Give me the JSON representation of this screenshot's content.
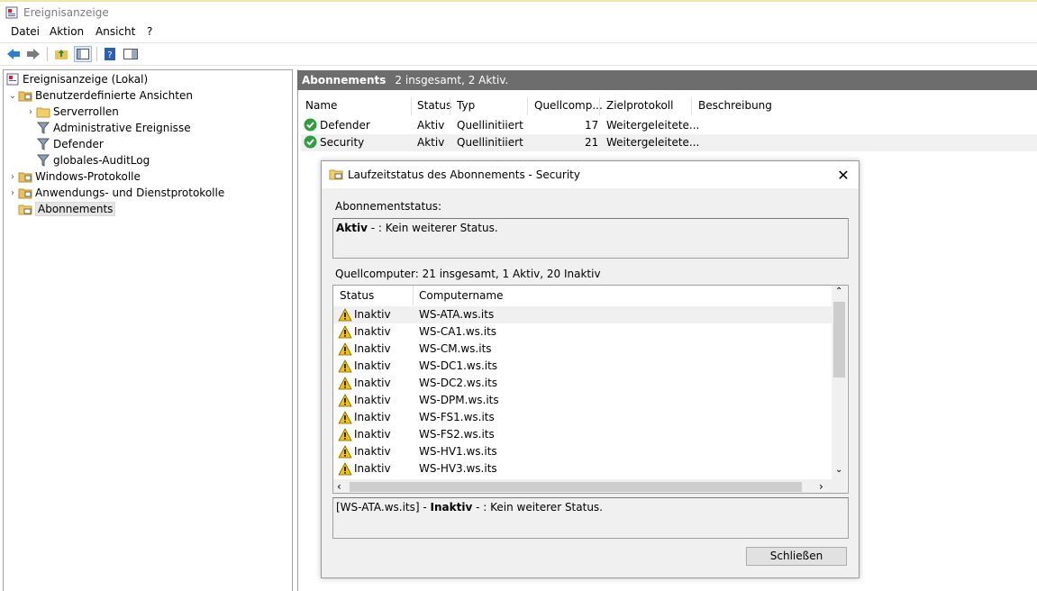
{
  "window": {
    "title": "Ereignisanzeige"
  },
  "menu": [
    "Datei",
    "Aktion",
    "Ansicht",
    "?"
  ],
  "toolbar": {
    "icons": [
      "arrow-back-icon",
      "arrow-forward-icon",
      "folder-up-icon",
      "console-tree-icon",
      "help-icon",
      "action-pane-icon"
    ]
  },
  "tree": {
    "root": "Ereignisanzeige (Lokal)",
    "custom_views": "Benutzerdefinierte Ansichten",
    "server_roles": "Serverrollen",
    "admin_events": "Administrative Ereignisse",
    "defender": "Defender",
    "audit_log": "globales-AuditLog",
    "windows_logs": "Windows-Protokolle",
    "app_logs": "Anwendungs- und Dienstprotokolle",
    "subscriptions": "Abonnements"
  },
  "panel": {
    "title": "Abonnements",
    "summary": "2 insgesamt, 2 Aktiv.",
    "columns": [
      "Name",
      "Status",
      "Typ",
      "Quellcomp...",
      "Zielprotokoll",
      "Beschreibung"
    ],
    "rows": [
      {
        "name": "Defender",
        "status": "Aktiv",
        "type": "Quellinitiiert",
        "count": "17",
        "target": "Weitergeleitete..."
      },
      {
        "name": "Security",
        "status": "Aktiv",
        "type": "Quellinitiiert",
        "count": "21",
        "target": "Weitergeleitete..."
      }
    ]
  },
  "dialog": {
    "title": "Laufzeitstatus des Abonnements - Security",
    "status_label": "Abonnementstatus:",
    "status_bold": "Aktiv",
    "status_rest": " - : Kein weiterer Status.",
    "source_label": "Quellcomputer: 21 insgesamt, 1 Aktiv, 20 Inaktiv",
    "list_columns": [
      "Status",
      "Computername"
    ],
    "computers": [
      {
        "status": "Inaktiv",
        "name": "WS-ATA.ws.its"
      },
      {
        "status": "Inaktiv",
        "name": "WS-CA1.ws.its"
      },
      {
        "status": "Inaktiv",
        "name": "WS-CM.ws.its"
      },
      {
        "status": "Inaktiv",
        "name": "WS-DC1.ws.its"
      },
      {
        "status": "Inaktiv",
        "name": "WS-DC2.ws.its"
      },
      {
        "status": "Inaktiv",
        "name": "WS-DPM.ws.its"
      },
      {
        "status": "Inaktiv",
        "name": "WS-FS1.ws.its"
      },
      {
        "status": "Inaktiv",
        "name": "WS-FS2.ws.its"
      },
      {
        "status": "Inaktiv",
        "name": "WS-HV1.ws.its"
      },
      {
        "status": "Inaktiv",
        "name": "WS-HV3.ws.its"
      }
    ],
    "detail_prefix": "[WS-ATA.ws.its] - ",
    "detail_bold": "Inaktiv",
    "detail_rest": " - : Kein weiterer Status.",
    "close_label": "Schließen"
  },
  "colors": {
    "header_bg": "#6d6d6d",
    "selection": "#e5e5e5",
    "warning": "#f5c400",
    "success": "#2e9e3e"
  }
}
